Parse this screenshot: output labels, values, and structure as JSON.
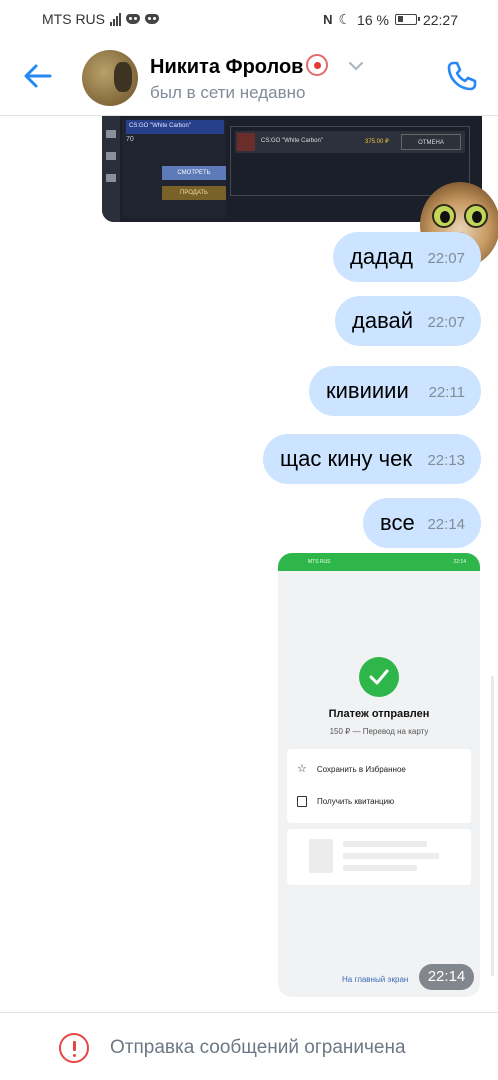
{
  "status_bar": {
    "carrier": "MTS RUS",
    "battery": "16 %",
    "time": "22:27"
  },
  "header": {
    "name": "Никита Фролов",
    "status": "был в сети недавно"
  },
  "game_screenshot": {
    "selected_item": "СS:GO \"White Carbon\"",
    "level": "70",
    "item_name": "СS:GO \"White Carbon\"",
    "price": "375.00 ₽",
    "cancel": "ОТМЕНА",
    "btn_view": "СМОТРЕТЬ",
    "btn_sell": "ПРОДАТЬ"
  },
  "messages": [
    {
      "text": "дадад",
      "time": "22:07"
    },
    {
      "text": "давай",
      "time": "22:07"
    },
    {
      "text": "кивииии",
      "time": "22:11"
    },
    {
      "text": "щас кину чек",
      "time": "22:13"
    },
    {
      "text": "все",
      "time": "22:14"
    }
  ],
  "receipt": {
    "carrier": "MTS RUS",
    "time_small": "22:14",
    "title": "Платеж отправлен",
    "subtitle": "150 ₽ — Перевод на карту",
    "option_save": "Сохранить в Избранное",
    "option_receipt": "Получить квитанцию",
    "home_link": "На главный экран",
    "time": "22:14"
  },
  "footer": {
    "restricted_text": "Отправка сообщений ограничена"
  },
  "colors": {
    "accent": "#2787f5",
    "bubble": "#cce4ff",
    "success": "#2fb64b",
    "warning": "#e64646"
  }
}
